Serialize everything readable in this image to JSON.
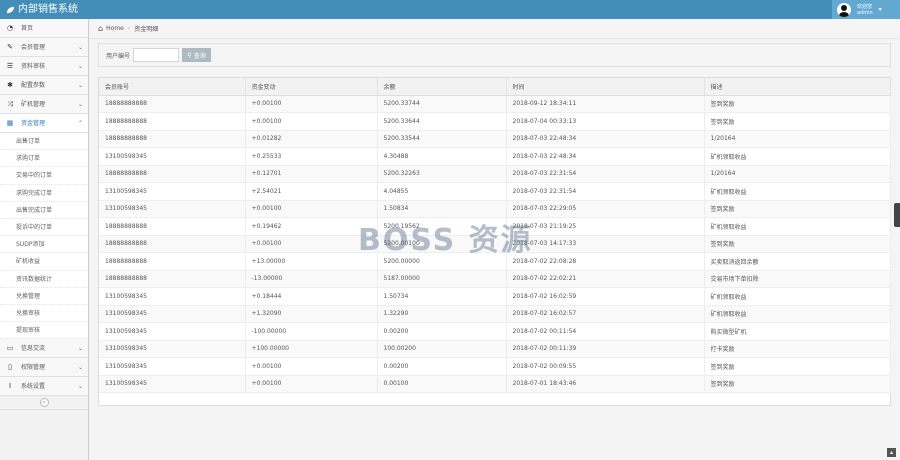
{
  "app": {
    "title": "内部销售系统"
  },
  "user": {
    "line1": "欢迎您",
    "line2": "admin"
  },
  "breadcrumb": {
    "home": "Home",
    "current": "资金明细"
  },
  "sidebar": {
    "items": [
      {
        "icon": "dashboard-icon",
        "glyph": "◔",
        "label": "首页",
        "arrow": ""
      },
      {
        "icon": "edit-icon",
        "glyph": "✎",
        "label": "会员管理",
        "arrow": "⌄"
      },
      {
        "icon": "list-icon",
        "glyph": "☰",
        "label": "资料审核",
        "arrow": "⌄"
      },
      {
        "icon": "bug-icon",
        "glyph": "✱",
        "label": "配置参数",
        "arrow": "⌄"
      },
      {
        "icon": "random-icon",
        "glyph": "⤨",
        "label": "矿机管理",
        "arrow": "⌄"
      },
      {
        "icon": "calendar-icon",
        "glyph": "▦",
        "label": "资金管理",
        "arrow": "⌃"
      }
    ],
    "submenu": [
      "出售订单",
      "求购订单",
      "交易中的订单",
      "求购完成订单",
      "出售完成订单",
      "投诉中的订单",
      "SUDP添加",
      "矿机收益",
      "资讯数据统计",
      "兑换管理",
      "兑换审核",
      "提现审核"
    ],
    "bottom_items": [
      {
        "icon": "desktop-icon",
        "glyph": "▭",
        "label": "信息交流",
        "arrow": "⌄"
      },
      {
        "icon": "file-icon",
        "glyph": "▯",
        "label": "权限管理",
        "arrow": "⌄"
      },
      {
        "icon": "text-icon",
        "glyph": "Ⅰ",
        "label": "系统设置",
        "arrow": "⌄"
      }
    ]
  },
  "search": {
    "label": "用户编号",
    "value": "",
    "placeholder": "",
    "button": "查询"
  },
  "table": {
    "headers": [
      "会员账号",
      "资金变动",
      "余额",
      "时间",
      "描述"
    ],
    "rows": [
      [
        "18888888888",
        "+0.00100",
        "5200.33744",
        "2018-09-12 18:34:11",
        "签到奖励"
      ],
      [
        "18888888888",
        "+0.00100",
        "5200.33644",
        "2018-07-04 00:33:13",
        "签到奖励"
      ],
      [
        "18888888888",
        "+0.01282",
        "5200.33544",
        "2018-07-03 22:48:34",
        "1/20164"
      ],
      [
        "13100598345",
        "+0.25533",
        "4.30488",
        "2018-07-03 22:48:34",
        "矿机领取收益"
      ],
      [
        "18888888888",
        "+0.12701",
        "5200.32263",
        "2018-07-03 22:31:54",
        "1/20164"
      ],
      [
        "13100598345",
        "+2.54021",
        "4.04855",
        "2018-07-03 22:31:54",
        "矿机领取收益"
      ],
      [
        "13100598345",
        "+0.00100",
        "1.50834",
        "2018-07-03 22:29:05",
        "签到奖励"
      ],
      [
        "18888888888",
        "+0.19462",
        "5200.19562",
        "2018-07-03 21:19:25",
        "矿机领取收益"
      ],
      [
        "18888888888",
        "+0.00100",
        "5200.00100",
        "2018-07-03 14:17:33",
        "签到奖励"
      ],
      [
        "18888888888",
        "+13.00000",
        "5200.00000",
        "2018-07-02 22:08:28",
        "买卖取消返回余额"
      ],
      [
        "18888888888",
        "-13.00000",
        "5187.00000",
        "2018-07-02 22:02:21",
        "交易市场下单扣除"
      ],
      [
        "13100598345",
        "+0.18444",
        "1.50734",
        "2018-07-02 16:02:59",
        "矿机领取收益"
      ],
      [
        "13100598345",
        "+1.32090",
        "1.32290",
        "2018-07-02 16:02:57",
        "矿机领取收益"
      ],
      [
        "13100598345",
        "-100.00000",
        "0.00200",
        "2018-07-02 00:11:54",
        "购买微型矿机"
      ],
      [
        "13100598345",
        "+100.00000",
        "100.00200",
        "2018-07-02 00:11:39",
        "打卡奖励"
      ],
      [
        "13100598345",
        "+0.00100",
        "0.00200",
        "2018-07-02 00:09:55",
        "签到奖励"
      ],
      [
        "13100598345",
        "+0.00100",
        "0.00100",
        "2018-07-01 18:43:46",
        "签到奖励"
      ]
    ]
  },
  "watermark": "BOSS 资源",
  "colors": {
    "topbar": "#438eb9",
    "active": "#2b7dbc"
  }
}
